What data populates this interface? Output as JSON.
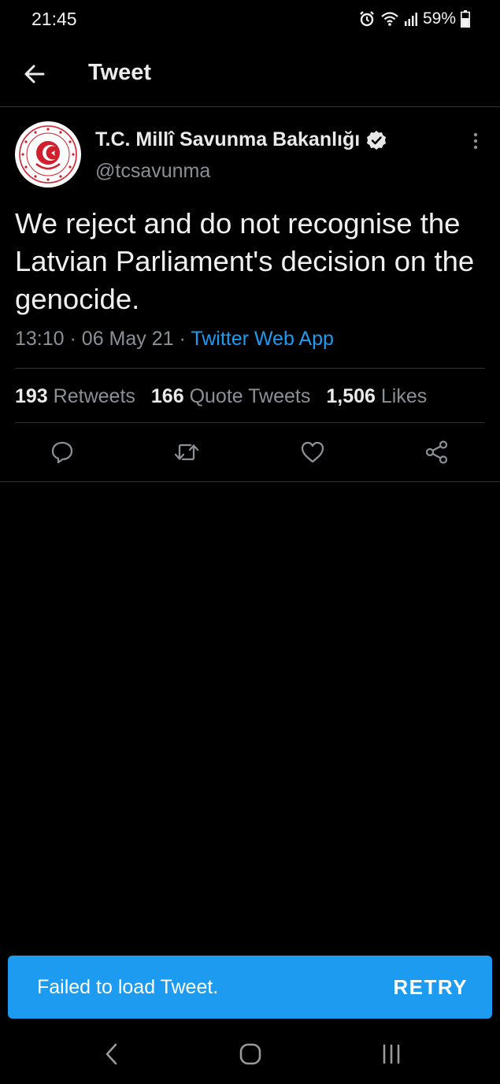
{
  "status_bar": {
    "time": "21:45",
    "battery": "59%",
    "icons": [
      "alarm-icon",
      "wifi-icon",
      "signal-icon",
      "battery-icon"
    ]
  },
  "header": {
    "title": "Tweet",
    "back_icon": "back-arrow-icon"
  },
  "tweet": {
    "author_name": "T.C. Millî Savunma Bakanlığı",
    "author_handle": "@tcsavunma",
    "text": "We reject and do not recognise the Latvian Parliament's decision on the genocide.",
    "time": "13:10",
    "date": "06 May 21",
    "source": "Twitter Web App",
    "separator": "·",
    "stats": {
      "retweets_count": "193",
      "retweets_label": "Retweets",
      "quotes_count": "166",
      "quotes_label": "Quote Tweets",
      "likes_count": "1,506",
      "likes_label": "Likes"
    },
    "actions": [
      "reply-icon",
      "retweet-icon",
      "like-icon",
      "share-icon"
    ]
  },
  "snackbar": {
    "message": "Failed to load Tweet.",
    "action": "RETRY"
  },
  "colors": {
    "background": "#000000",
    "accent": "#1d9bf0",
    "muted_text": "#8b9095",
    "divider": "#2f3336",
    "logo_red": "#d0202e"
  },
  "nav_bar": {
    "buttons": [
      "recents-icon",
      "home-icon",
      "back-icon"
    ]
  }
}
